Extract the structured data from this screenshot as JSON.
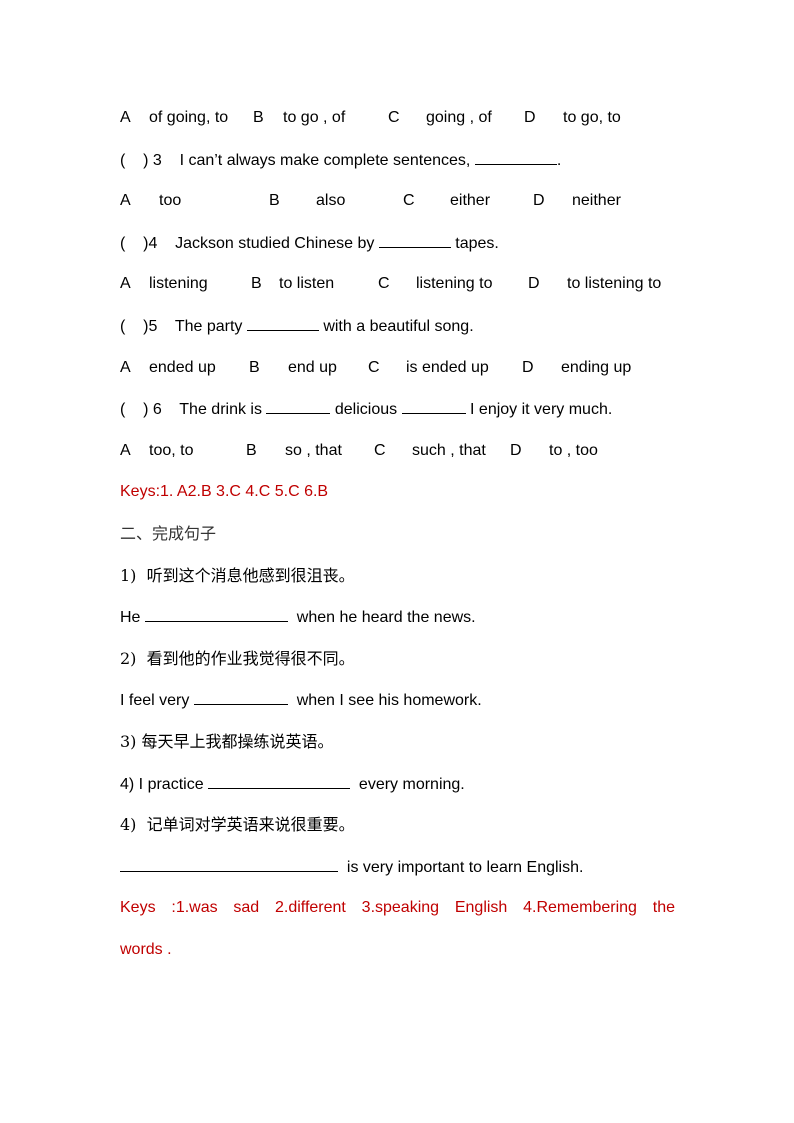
{
  "section1": {
    "q2_options": {
      "A": "of going, to",
      "B": "to go , of",
      "C": "going , of",
      "D": "to go, to"
    },
    "q3": {
      "prefix": "(    ) 3",
      "text_before": "I can’t always make complete sentences, ",
      "text_after": "."
    },
    "q3_options": {
      "A": "too",
      "B": "also",
      "C": "either",
      "D": "neither"
    },
    "q4": {
      "prefix": "(    )4",
      "text_before": "Jackson studied Chinese by ",
      "text_after": " tapes."
    },
    "q4_options": {
      "A": "listening",
      "B": "to listen",
      "C": "listening to",
      "D": "to listening to"
    },
    "q5": {
      "prefix": "(    )5",
      "text_before": "The party ",
      "text_after": " with a beautiful song."
    },
    "q5_options": {
      "A": "ended up",
      "B": "end up",
      "C": "is ended up",
      "D": "ending up"
    },
    "q6": {
      "prefix": "(    ) 6",
      "text_before": "The drink is ",
      "text_middle": " delicious ",
      "text_after": " I enjoy it very much."
    },
    "q6_options": {
      "A": "too, to",
      "B": "so , that",
      "C": "such , that",
      "D": "to , too"
    },
    "keys": "Keys:1. A2.B 3.C 4.C 5.C 6.B"
  },
  "letters": {
    "A": "A",
    "B": "B",
    "C": "C",
    "D": "D"
  },
  "section2": {
    "heading": "二、完成句子",
    "items": [
      {
        "zh": "1)  听到这个消息他感到很沮丧。",
        "en_before": "He ",
        "en_after": "  when he heard the news."
      },
      {
        "zh": "2)  看到他的作业我觉得很不同。",
        "en_before": "I feel very ",
        "en_after": "  when I see his homework."
      },
      {
        "zh": "3) 每天早上我都操练说英语。",
        "en_before": "4) I practice ",
        "en_after": "  every morning."
      },
      {
        "zh": "4)  记单词对学英语来说很重要。",
        "en_before": "",
        "en_after": "  is very important to learn English."
      }
    ],
    "keys_line1": "Keys  :1.was  sad  2.different  3.speaking  English  4.Remembering  the",
    "keys_line2": "words ."
  },
  "colors": {
    "key_text": "#c00000",
    "body_text": "#000000"
  }
}
